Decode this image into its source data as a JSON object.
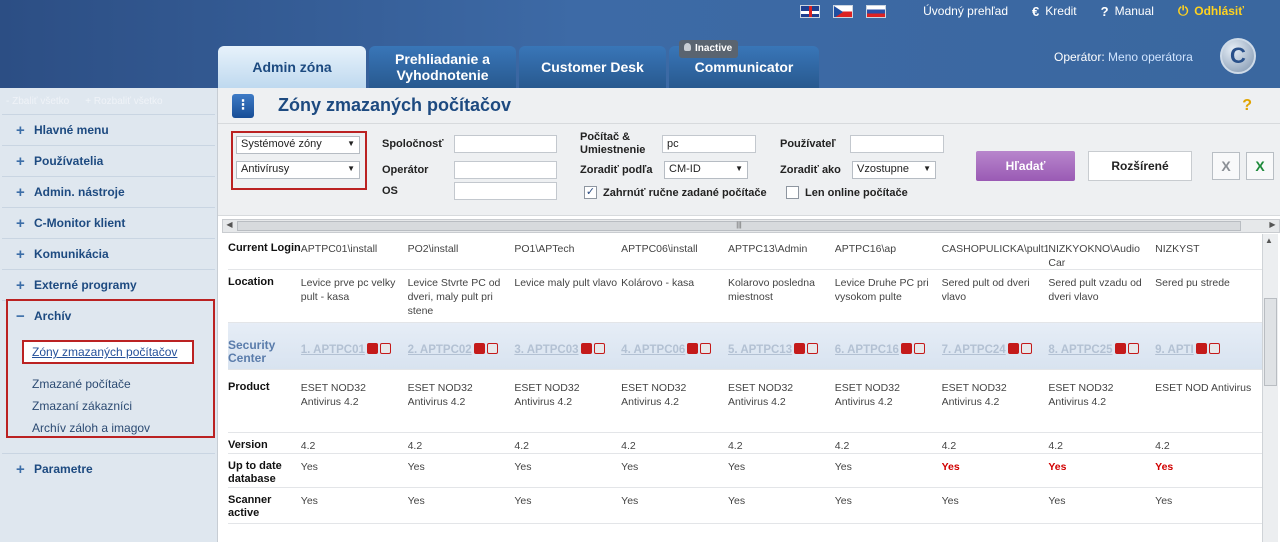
{
  "topbar": {
    "home": "Úvodný prehľad",
    "credit": "Kredit",
    "manual": "Manual",
    "logout": "Odhlásiť",
    "credit_icon": "€",
    "manual_icon": "?",
    "logout_icon": "⏻"
  },
  "tabs": [
    {
      "label": "Admin zóna"
    },
    {
      "label": "Prehliadanie a Vyhodnotenie"
    },
    {
      "label": "Customer Desk"
    },
    {
      "label": "Communicator",
      "badge": "Inactive"
    }
  ],
  "operator": {
    "label": "Operátor:",
    "name": "Meno operátora"
  },
  "logo_letter": "C",
  "sidebar": {
    "collapse_all": "Zbaliť všetko",
    "expand_all": "Rozbaliť všetko",
    "items": [
      {
        "label": "Hlavné menu"
      },
      {
        "label": "Používatelia"
      },
      {
        "label": "Admin. nástroje"
      },
      {
        "label": "C-Monitor klient"
      },
      {
        "label": "Komunikácia"
      },
      {
        "label": "Externé programy"
      },
      {
        "label": "Archív"
      },
      {
        "label": "Parametre"
      }
    ],
    "archiv_sub": [
      {
        "label": "Zóny zmazaných počítačov"
      },
      {
        "label": "Zmazané počítače"
      },
      {
        "label": "Zmazaní zákazníci"
      },
      {
        "label": "Archív záloh a imagov"
      }
    ]
  },
  "page": {
    "title": "Zóny zmazaných počítačov",
    "help": "?"
  },
  "filters": {
    "zone_select": "Systémové zóny",
    "type_select": "Antivírusy",
    "company_label": "Spoločnosť",
    "operator_label": "Operátor",
    "os_label": "OS",
    "computer_label": "Počítač & Umiestnenie",
    "computer_value": "pc",
    "sort_by_label": "Zoradiť podľa",
    "sort_by_value": "CM-ID",
    "include_manual": "Zahrnúť ručne zadané počítače",
    "user_label": "Používateľ",
    "sort_as_label": "Zoradiť ako",
    "sort_as_value": "Vzostupne",
    "online_only": "Len online počítače",
    "search_button": "Hľadať",
    "advanced_button": "Rozšírené"
  },
  "grid": {
    "row_labels": {
      "login": "Current Login",
      "location": "Location",
      "security": "Security Center",
      "product": "Product",
      "version": "Version",
      "uptodate": "Up to date database",
      "scanner": "Scanner active"
    },
    "columns": [
      {
        "login": "APTPC01\\install",
        "location": "Levice prve pc velky pult - kasa",
        "sc": "1. APTPC01",
        "product": "ESET NOD32 Antivirus 4.2",
        "version": "4.2",
        "uptodate": "Yes",
        "scanner": "Yes",
        "red": false
      },
      {
        "login": "PO2\\install",
        "location": "Levice Stvrte PC od dveri, maly pult pri stene",
        "sc": "2. APTPC02",
        "product": "ESET NOD32 Antivirus 4.2",
        "version": "4.2",
        "uptodate": "Yes",
        "scanner": "Yes",
        "red": false
      },
      {
        "login": "PO1\\APTech",
        "location": "Levice maly pult vlavo",
        "sc": "3. APTPC03",
        "product": "ESET NOD32 Antivirus 4.2",
        "version": "4.2",
        "uptodate": "Yes",
        "scanner": "Yes",
        "red": false
      },
      {
        "login": "APTPC06\\install",
        "location": "Kolárovo - kasa",
        "sc": "4. APTPC06",
        "product": "ESET NOD32 Antivirus 4.2",
        "version": "4.2",
        "uptodate": "Yes",
        "scanner": "Yes",
        "red": false
      },
      {
        "login": "APTPC13\\Admin",
        "location": "Kolarovo posledna miestnost",
        "sc": "5. APTPC13",
        "product": "ESET NOD32 Antivirus 4.2",
        "version": "4.2",
        "uptodate": "Yes",
        "scanner": "Yes",
        "red": false
      },
      {
        "login": "APTPC16\\ap",
        "location": "Levice Druhe PC pri vysokom pulte",
        "sc": "6. APTPC16",
        "product": "ESET NOD32 Antivirus 4.2",
        "version": "4.2",
        "uptodate": "Yes",
        "scanner": "Yes",
        "red": false
      },
      {
        "login": "CASHOPULICKA\\pult1",
        "location": "Sered pult od dveri vlavo",
        "sc": "7. APTPC24",
        "product": "ESET NOD32 Antivirus 4.2",
        "version": "4.2",
        "uptodate": "Yes",
        "scanner": "Yes",
        "red": true
      },
      {
        "login": "NIZKYOKNO\\Audio Car",
        "location": "Sered pult vzadu od dveri vlavo",
        "sc": "8. APTPC25",
        "product": "ESET NOD32 Antivirus 4.2",
        "version": "4.2",
        "uptodate": "Yes",
        "scanner": "Yes",
        "red": true
      },
      {
        "login": "NIZKYST",
        "location": "Sered pu strede",
        "sc": "9. APTI",
        "product": "ESET NOD Antivirus",
        "version": "4.2",
        "uptodate": "Yes",
        "scanner": "Yes",
        "red": true
      }
    ]
  }
}
